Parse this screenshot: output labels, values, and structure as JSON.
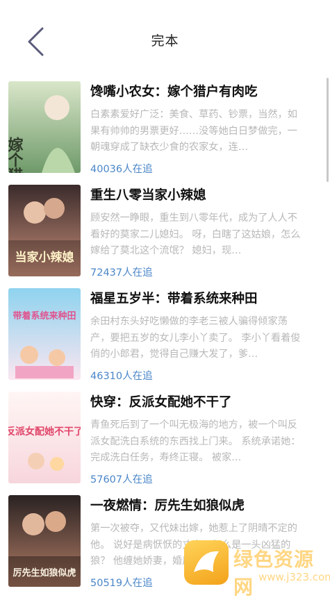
{
  "header": {
    "title": "完本"
  },
  "books": [
    {
      "title": "馋嘴小农女：嫁个猎户有肉吃",
      "description": "白素素爱好广泛：美食、草药、钞票，当然，如果有帅帅的男票更好……没等她白日梦做完，一朝魂穿成了缺衣少食的农家女，连…",
      "followers": "40036人在追",
      "cover_text": "嫁个猎户",
      "cover_colors": [
        "#6f9a6a",
        "#d9e6c9",
        "#2f5a2e"
      ]
    },
    {
      "title": "重生八零当家小辣媳",
      "description": "顾安然一睁眼，重生到八零年代，成为了人人不看好的莫家二儿媳妇。 呀，白瞎了这姑娘，怎么嫁给了莫北这个流氓？ 媳妇，现…",
      "followers": "72437人在追",
      "cover_text": "当家小辣媳",
      "cover_colors": [
        "#3a2b2b",
        "#c98f7a",
        "#f2d9a8"
      ]
    },
    {
      "title": "福星五岁半：带着系统来种田",
      "description": "余田村东头好吃懒做的李老三被人骗得倾家荡产，要把五岁的女儿李小丫卖了。 李小丫看着俊俏的小郎君，觉得自己赚大发了，爹…",
      "followers": "46310人在追",
      "cover_text": "带着系统来种田",
      "cover_colors": [
        "#8fd3ef",
        "#fbe6f0",
        "#e0548f"
      ]
    },
    {
      "title": "快穿：反派女配她不干了",
      "description": "青鱼死后到了一个叫无极海的地方，被一个叫反派女配洗白系统的东西找上门来。 系统承诺她：完成洗白任务，寿终正寝。 被家…",
      "followers": "57607人在追",
      "cover_text": "反派女配她不干了",
      "cover_colors": [
        "#f7d6dd",
        "#fff6f4",
        "#e0456a"
      ]
    },
    {
      "title": "一夜燃情：厉先生如狼似虎",
      "description": "第一次被夺，又代妹出嫁，她惹上了阴晴不定的他。 说好是病恹恹的丈夫，怎么是一头凶猛的狼？ 他缠她娇妻，婚后夜夜…",
      "followers": "50519人在追",
      "cover_text": "厉先生如狼似虎",
      "cover_colors": [
        "#2a2222",
        "#b47e67",
        "#e8c9a8"
      ]
    }
  ],
  "watermark": {
    "name": "绿色资源网",
    "url": "www.j323.com"
  }
}
